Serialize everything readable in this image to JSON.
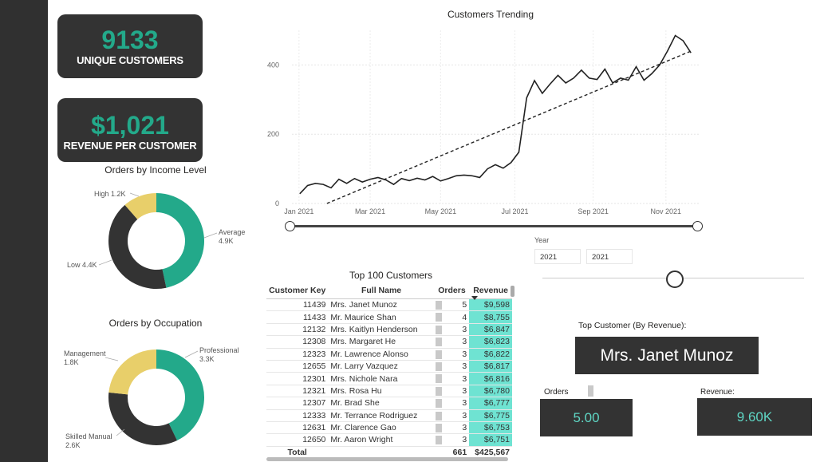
{
  "kpis": {
    "unique_customers": {
      "value": "9133",
      "label": "UNIQUE CUSTOMERS"
    },
    "revenue_per_customer": {
      "value": "$1,021",
      "label": "REVENUE PER CUSTOMER"
    }
  },
  "income_chart": {
    "title": "Orders by Income Level",
    "slices": [
      {
        "label": "Average",
        "value": "4.9K",
        "color": "#23a98a"
      },
      {
        "label": "Low",
        "value": "4.4K",
        "color": "#333333"
      },
      {
        "label": "High",
        "value": "1.2K",
        "color": "#e8cf6a"
      }
    ]
  },
  "occupation_chart": {
    "title": "Orders by Occupation",
    "slices": [
      {
        "label": "Professional",
        "value": "3.3K",
        "color": "#23a98a"
      },
      {
        "label": "Skilled Manual",
        "value": "2.6K",
        "color": "#333333"
      },
      {
        "label": "Management",
        "value": "1.8K",
        "color": "#e8cf6a"
      }
    ]
  },
  "trend_chart": {
    "title": "Customers Trending",
    "y_ticks": [
      "0",
      "200",
      "400"
    ],
    "x_ticks": [
      "Jan 2021",
      "Mar 2021",
      "May 2021",
      "Jul 2021",
      "Sep 2021",
      "Nov 2021"
    ]
  },
  "chart_data": [
    {
      "type": "pie",
      "title": "Orders by Income Level",
      "categories": [
        "Average",
        "Low",
        "High"
      ],
      "values": [
        4900,
        4400,
        1200
      ]
    },
    {
      "type": "pie",
      "title": "Orders by Occupation",
      "categories": [
        "Professional",
        "Skilled Manual",
        "Management"
      ],
      "values": [
        3300,
        2600,
        1800
      ]
    },
    {
      "type": "line",
      "title": "Customers Trending",
      "ylim": [
        0,
        500
      ],
      "x_range": [
        "2021-01-01",
        "2021-12-31"
      ],
      "x": [
        2,
        3,
        4,
        5,
        6,
        7,
        8,
        9,
        10,
        11,
        12,
        13,
        14,
        15,
        16,
        17,
        18,
        19,
        20,
        21,
        22,
        23,
        24,
        25,
        26,
        27,
        28,
        29,
        30,
        31,
        32,
        33,
        34,
        35,
        36,
        37,
        38,
        39,
        40,
        41,
        42,
        43,
        44,
        45,
        46,
        47,
        48,
        49,
        50,
        51,
        52
      ],
      "values": [
        28,
        52,
        58,
        55,
        45,
        70,
        58,
        72,
        62,
        70,
        75,
        68,
        55,
        72,
        66,
        73,
        68,
        78,
        65,
        72,
        80,
        82,
        80,
        75,
        100,
        112,
        102,
        118,
        148,
        305,
        355,
        318,
        345,
        370,
        348,
        362,
        385,
        362,
        358,
        388,
        348,
        362,
        356,
        395,
        356,
        375,
        400,
        440,
        485,
        470,
        435
      ],
      "trend_line": {
        "start": 0,
        "end": 440
      }
    }
  ],
  "table": {
    "title": "Top 100 Customers",
    "headers": {
      "key": "Customer Key",
      "name": "Full Name",
      "orders": "Orders",
      "revenue": "Revenue"
    },
    "rows": [
      {
        "key": "11439",
        "name": "Mrs. Janet Munoz",
        "orders": "5",
        "revenue": "$9,598"
      },
      {
        "key": "11433",
        "name": "Mr. Maurice Shan",
        "orders": "4",
        "revenue": "$8,755"
      },
      {
        "key": "12132",
        "name": "Mrs. Kaitlyn Henderson",
        "orders": "3",
        "revenue": "$6,847"
      },
      {
        "key": "12308",
        "name": "Mrs. Margaret He",
        "orders": "3",
        "revenue": "$6,823"
      },
      {
        "key": "12323",
        "name": "Mr. Lawrence Alonso",
        "orders": "3",
        "revenue": "$6,822"
      },
      {
        "key": "12655",
        "name": "Mr. Larry Vazquez",
        "orders": "3",
        "revenue": "$6,817"
      },
      {
        "key": "12301",
        "name": "Mrs. Nichole Nara",
        "orders": "3",
        "revenue": "$6,816"
      },
      {
        "key": "12321",
        "name": "Mrs. Rosa Hu",
        "orders": "3",
        "revenue": "$6,780"
      },
      {
        "key": "12307",
        "name": "Mr. Brad She",
        "orders": "3",
        "revenue": "$6,777"
      },
      {
        "key": "12333",
        "name": "Mr. Terrance Rodriguez",
        "orders": "3",
        "revenue": "$6,775"
      },
      {
        "key": "12631",
        "name": "Mr. Clarence Gao",
        "orders": "3",
        "revenue": "$6,753"
      },
      {
        "key": "12650",
        "name": "Mr. Aaron Wright",
        "orders": "3",
        "revenue": "$6,751"
      }
    ],
    "total": {
      "label": "Total",
      "orders": "661",
      "revenue": "$425,567"
    }
  },
  "year_filter": {
    "label": "Year",
    "from": "2021",
    "to": "2021"
  },
  "top_customer": {
    "label": "Top Customer (By Revenue):",
    "name": "Mrs. Janet Munoz",
    "orders_label": "Orders",
    "orders_value": "5.00",
    "revenue_label": "Revenue:",
    "revenue_value": "9.60K"
  }
}
